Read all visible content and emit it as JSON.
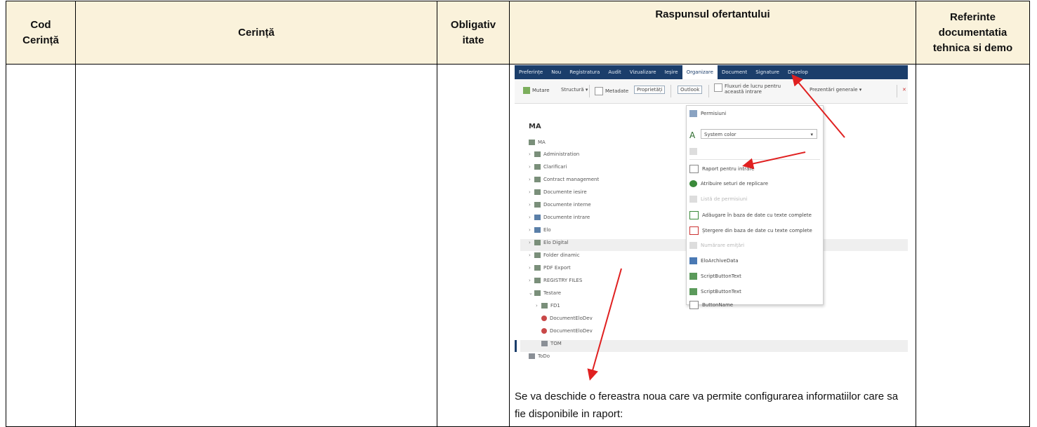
{
  "table": {
    "headers": {
      "cod": "Cod\nCerință",
      "cerinta": "Cerință",
      "obligativ": "Obligativ\nitate",
      "raspuns": "Raspunsul ofertantului",
      "referinte": "Referinte\ndocumentatia\ntehnica si demo"
    },
    "response_text": "Se va deschide o fereastra noua care va permite configurarea informatiilor care sa fie disponibile in raport:"
  },
  "screenshot": {
    "menu": [
      "Preferințe",
      "Nou",
      "Registratura",
      "Audit",
      "Vizualizare",
      "Ieșire",
      "Organizare",
      "Document",
      "Signature",
      "Develop"
    ],
    "toolbar": {
      "mutare": "Mutare",
      "structura": "Structură",
      "metadate": "Metadate",
      "proprietati": "Proprietăți",
      "outlook": "Outlook",
      "fluxuri": "Fluxuri de lucru pentru această intrare",
      "prezentari": "Prezentări generale"
    },
    "tree_title": "MA",
    "tree": [
      "MA",
      "Administration",
      "Clarificari",
      "Contract management",
      "Documente iesire",
      "Documente interne",
      "Documente intrare",
      "Elo",
      "Elo Digital",
      "Folder dinamic",
      "PDF Export",
      "REGISTRY FILES",
      "Testare",
      "FD1",
      "DocumentEloDev",
      "DocumentEloDev",
      "TOM",
      "ToDo"
    ],
    "dropdown": {
      "permisiuni": "Permisiuni",
      "system_color": "System color",
      "items": [
        "Raport pentru intrare",
        "Atribuire seturi de replicare",
        "Listă de permisiuni",
        "Adăugare în baza de date cu texte complete",
        "Ștergere din baza de date cu texte complete",
        "Numărare emiţări",
        "EloArchiveData",
        "ScriptButtonText",
        "ScriptButtonText",
        "ButtonName"
      ]
    }
  }
}
